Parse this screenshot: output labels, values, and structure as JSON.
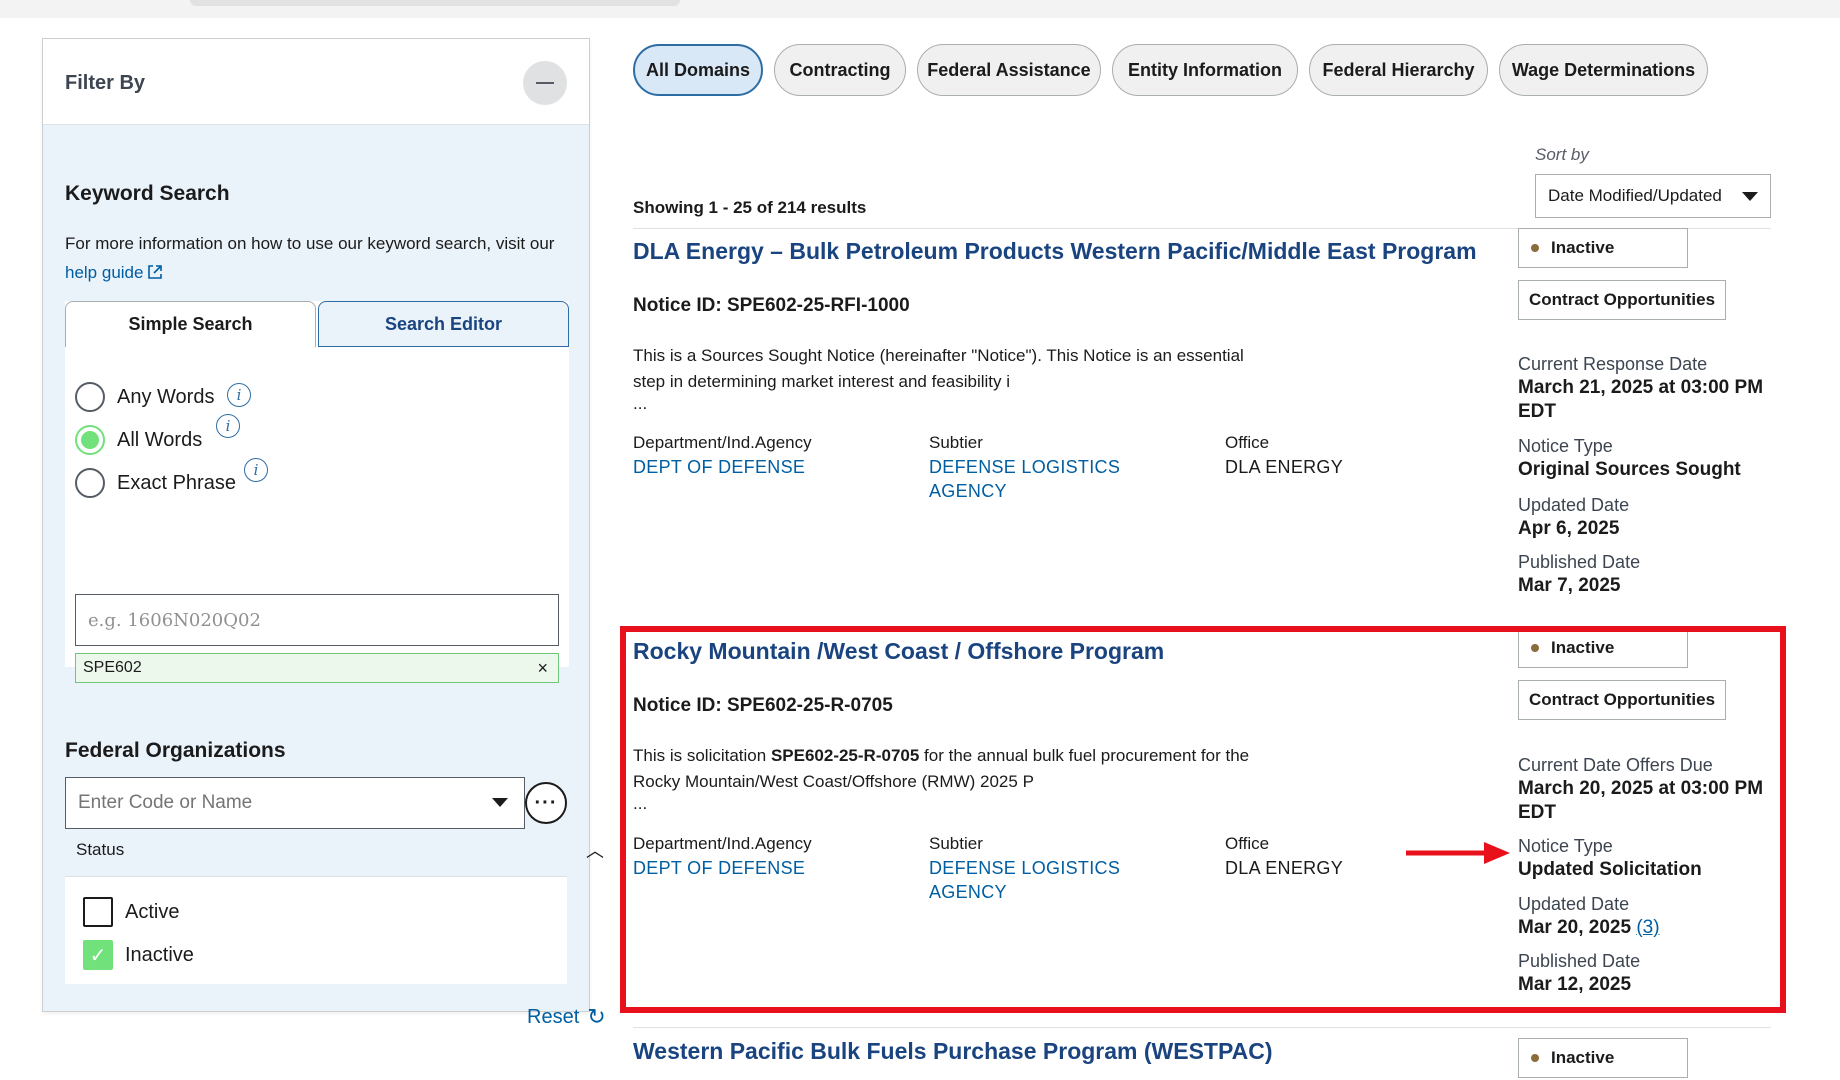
{
  "filter": {
    "title": "Filter By",
    "keyword": {
      "title": "Keyword Search",
      "info_text": "For more information on how to use our keyword search, visit our ",
      "help_link": "help guide",
      "tabs": [
        "Simple Search",
        "Search Editor"
      ],
      "options": [
        "Any Words",
        "All Words",
        "Exact Phrase"
      ],
      "selected_option": "All Words",
      "placeholder": "e.g. 1606N020Q02",
      "chip": "SPE602"
    },
    "federal_orgs": {
      "title": "Federal Organizations",
      "placeholder": "Enter Code or Name"
    },
    "status": {
      "label": "Status",
      "options": [
        {
          "label": "Active",
          "checked": false
        },
        {
          "label": "Inactive",
          "checked": true
        }
      ]
    },
    "reset_label": "Reset"
  },
  "domains": [
    "All Domains",
    "Contracting",
    "Federal Assistance",
    "Entity Information",
    "Federal Hierarchy",
    "Wage Determinations"
  ],
  "active_domain": "All Domains",
  "sort": {
    "label": "Sort by",
    "value": "Date Modified/Updated"
  },
  "showing": "Showing 1 - 25 of 214 results",
  "col_labels": {
    "dept": "Department/Ind.Agency",
    "subtier": "Subtier",
    "office": "Office"
  },
  "results": [
    {
      "title": "DLA Energy – Bulk Petroleum Products Western Pacific/Middle East Program",
      "notice_id": "Notice ID: SPE602-25-RFI-1000",
      "desc_line1": "This is a Sources Sought Notice (hereinafter \"Notice\"). This Notice is an essential",
      "desc_line2": "step in determining market interest and feasibility i",
      "ellipsis": "...",
      "dept": "DEPT OF DEFENSE",
      "subtier_line1": "DEFENSE LOGISTICS",
      "subtier_line2": "AGENCY",
      "office": "DLA ENERGY",
      "status": "Inactive",
      "type": "Contract Opportunities",
      "date_label": "Current Response Date",
      "date_line1": "March 21, 2025 at 03:00 PM",
      "date_line2": "EDT",
      "notice_type_label": "Notice Type",
      "notice_type": "Original Sources Sought",
      "updated_label": "Updated Date",
      "updated": "Apr 6, 2025",
      "published_label": "Published Date",
      "published": "Mar 7, 2025"
    },
    {
      "title": "Rocky Mountain /West Coast / Offshore Program",
      "notice_id": "Notice ID: SPE602-25-R-0705",
      "desc_prefix": "This is solicitation ",
      "desc_bold": "SPE602-25-R-0705",
      "desc_suffix": " for the annual bulk fuel procurement for the",
      "desc_line2": "Rocky Mountain/West Coast/Offshore (RMW) 2025 P",
      "ellipsis": "...",
      "dept": "DEPT OF DEFENSE",
      "subtier_line1": "DEFENSE LOGISTICS",
      "subtier_line2": "AGENCY",
      "office": "DLA ENERGY",
      "status": "Inactive",
      "type": "Contract Opportunities",
      "date_label": "Current Date Offers Due",
      "date_line1": "March 20, 2025 at 03:00 PM",
      "date_line2": "EDT",
      "notice_type_label": "Notice Type",
      "notice_type": "Updated Solicitation",
      "updated_label": "Updated Date",
      "updated": "Mar 20, 2025",
      "updated_count": "(3)",
      "published_label": "Published Date",
      "published": "Mar 12, 2025"
    },
    {
      "title": "Western Pacific Bulk Fuels Purchase Program (WESTPAC)",
      "status": "Inactive"
    }
  ],
  "colors": {
    "highlight": "#e8101a",
    "link": "#1a4480",
    "check": "#70e17b"
  }
}
